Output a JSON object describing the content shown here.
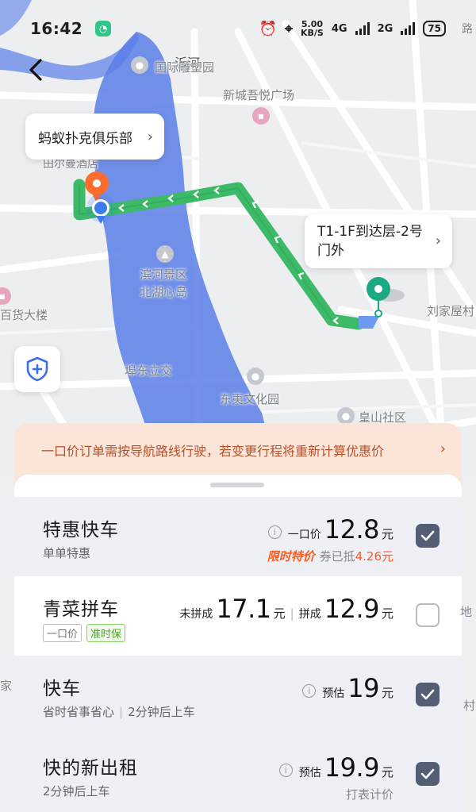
{
  "status_bar": {
    "time": "16:42",
    "speed_value": "5.00",
    "speed_unit": "KB/S",
    "network_1": "4G",
    "network_2": "2G",
    "battery": "75"
  },
  "map": {
    "labels": {
      "river": "沂河",
      "garden": "国际雕塑园",
      "plaza": "新城吾悦广场",
      "hotel": "田尔曼酒店",
      "scenic_1": "滨河景区",
      "scenic_2": "北湖心岛",
      "store": "百货大楼",
      "interchange": "埠东立交",
      "culture_park": "东夷文化园",
      "community": "皇山社区",
      "village": "刘家屋村",
      "edge_top": "路",
      "edge_right_1": "地",
      "edge_right_2": "村",
      "edge_left": "家"
    },
    "origin_callout": "蚂蚁扑克俱乐部",
    "dest_callout": "T1-1F到达层-2号门外"
  },
  "notice": {
    "text": "一口价订单需按导航路线行驶，若变更行程将重新计算优惠价"
  },
  "rides": [
    {
      "name": "特惠快车",
      "sub": "单单特惠",
      "price_label": "一口价",
      "price": "12.8",
      "unit": "元",
      "promo_tag": "限时特价",
      "promo_text": "券已抵",
      "promo_amount": "4.26元",
      "checked": true
    },
    {
      "name": "青菜拼车",
      "tag_1": "一口价",
      "tag_2": "准时保",
      "label_a": "未拼成",
      "price_a": "17.1",
      "label_b": "拼成",
      "price_b": "12.9",
      "unit": "元",
      "checked": false
    },
    {
      "name": "快车",
      "sub_a": "省时省事省心",
      "sub_b": "2分钟后上车",
      "price_label": "预估",
      "price": "19",
      "unit": "元",
      "checked": true
    },
    {
      "name": "快的新出租",
      "sub": "2分钟后上车",
      "price_label": "预估",
      "price": "19.9",
      "unit": "元",
      "extra": "打表计价",
      "checked": true
    }
  ],
  "colors": {
    "route": "#3cba68",
    "river": "#5b7ee8",
    "origin_pin": "#ff6b2c",
    "dest_pin": "#1aa982",
    "checkbox": "#535d74",
    "notice_text": "#b8512a"
  }
}
